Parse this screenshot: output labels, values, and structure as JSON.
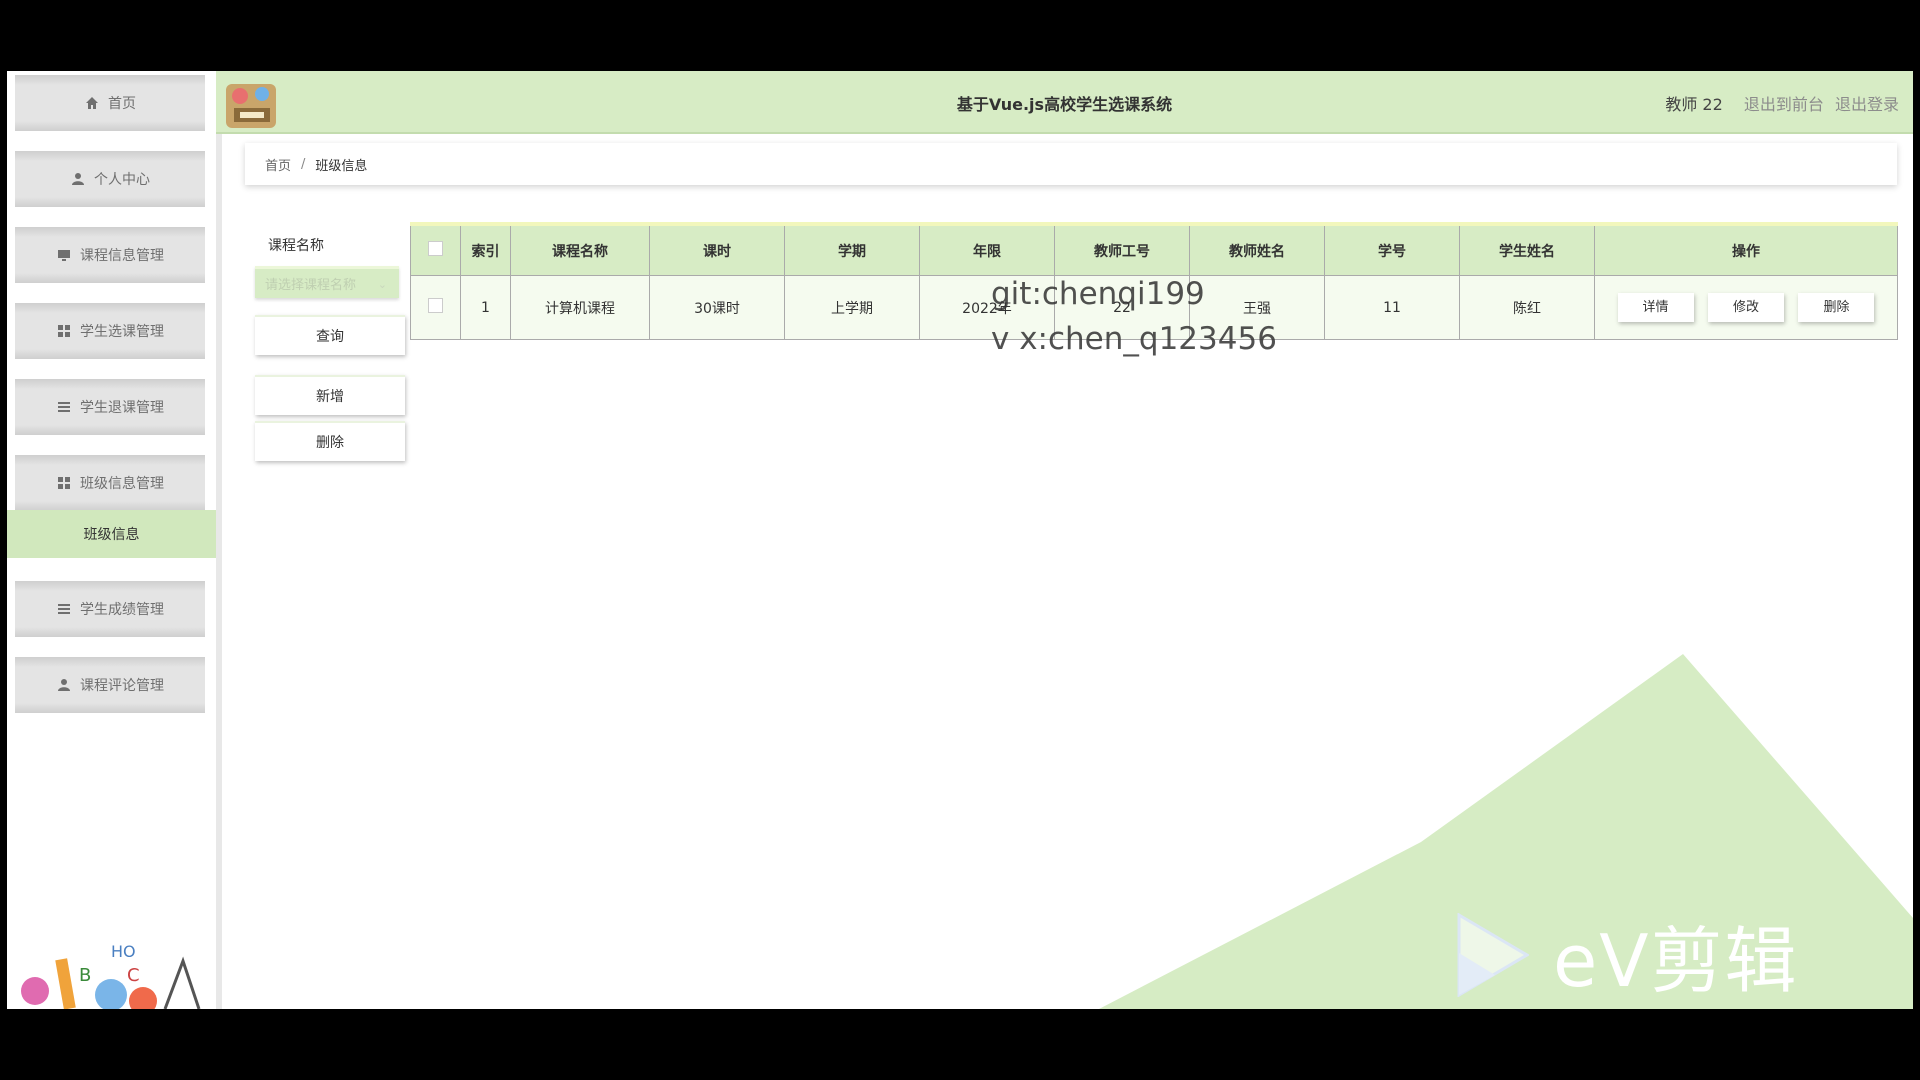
{
  "header": {
    "title": "基于Vue.js高校学生选课系统",
    "user": "教师 22",
    "link_front": "退出到前台",
    "link_logout": "退出登录"
  },
  "sidebar": {
    "items": [
      {
        "label": "首页",
        "icon": "home-icon"
      },
      {
        "label": "个人中心",
        "icon": "user-icon"
      },
      {
        "label": "课程信息管理",
        "icon": "monitor-icon"
      },
      {
        "label": "学生选课管理",
        "icon": "grid-icon"
      },
      {
        "label": "学生退课管理",
        "icon": "list-icon"
      },
      {
        "label": "班级信息管理",
        "icon": "grid-icon"
      },
      {
        "label": "学生成绩管理",
        "icon": "list-icon"
      },
      {
        "label": "课程评论管理",
        "icon": "user-icon"
      }
    ],
    "active_sub": "班级信息"
  },
  "breadcrumb": {
    "home": "首页",
    "sep": "/",
    "current": "班级信息"
  },
  "search": {
    "label": "课程名称",
    "placeholder": "请选择课程名称",
    "query": "查询",
    "add": "新增",
    "delete": "删除"
  },
  "table": {
    "headers": [
      "索引",
      "课程名称",
      "课时",
      "学期",
      "年限",
      "教师工号",
      "教师姓名",
      "学号",
      "学生姓名",
      "操作"
    ],
    "rows": [
      {
        "index": "1",
        "course": "计算机课程",
        "hours": "30课时",
        "term": "上学期",
        "year": "2022年",
        "teacher_id": "22",
        "teacher_name": "王强",
        "student_id": "11",
        "student_name": "陈红"
      }
    ],
    "actions": {
      "detail": "详情",
      "edit": "修改",
      "delete": "删除"
    }
  },
  "watermark": {
    "line1": "git:chenqi199",
    "line2": "v x:chen_q123456"
  },
  "overlay": {
    "ev_brand": "eV剪辑"
  },
  "colors": {
    "accent": "#d7ecc5",
    "active": "#d1e8bd",
    "deco": "#d6ecc4",
    "background": "#000000"
  }
}
